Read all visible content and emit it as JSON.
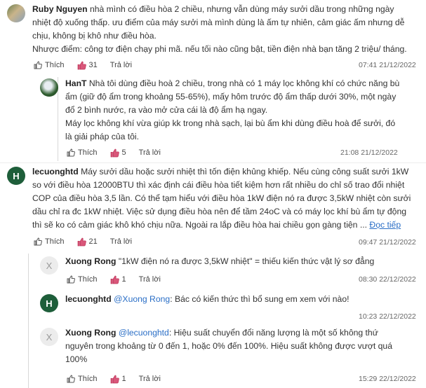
{
  "labels": {
    "like": "Thích",
    "reply": "Trả lời"
  },
  "comments": [
    {
      "author": "Ruby Nguyen",
      "text_line1": "nhà mình có điều hòa 2 chiều, nhưng vẫn dùng máy sưởi dầu trong những ngày",
      "text_line2": "nhiệt độ xuống thấp. ưu điểm của máy sưởi mà mình dùng là ấm tự nhiên, cảm giác ấm nhưng dễ",
      "text_line3": "chịu, không bị khô như điều hòa.",
      "text_line4": "Nhược điểm: công tơ điện chạy phi mã. nếu tối nào cũng bật, tiền điện nhà bạn tăng 2 triệu/ tháng.",
      "likes": "31",
      "time": "07:41 21/12/2022"
    },
    {
      "author": "HanT",
      "text_line1": "Nhà tôi dùng điều hoà 2 chiều, trong nhà có 1 máy lọc không khí có chức năng bù",
      "text_line2": "ẩm (giữ độ ẩm trong khoảng 55-65%), mấy hôm trước độ ẩm thấp dưới 30%, một ngày",
      "text_line3": "đổ 2 bình nước, ra vào mở cửa cái là độ ẩm hạ ngay.",
      "text_line4": "Máy lọc không khí vừa giúp kk trong nhà sạch, lại bù ẩm khi dùng điều hoà để sưởi, đó",
      "text_line5": "là giải pháp của tôi.",
      "likes": "5",
      "time": "21:08 21/12/2022"
    },
    {
      "author": "lecuonghtd",
      "avatar_letter": "H",
      "text_line1": "Máy sưởi dầu hoặc sưởi nhiệt thì tốn điện khủng khiếp. Nếu cùng công suất sưởi 1kW",
      "text_line2": "so với điều hòa 12000BTU thì xác định cái điều hòa tiết kiệm hơn rất nhiều do chỉ số trao đổi nhiệt",
      "text_line3": "COP của điều hòa 3,5 lần. Có thể tạm hiểu với điều hòa 1kW điện nó ra được 3,5kW nhiệt còn sưởi",
      "text_line4": "dầu chỉ ra đc 1kW nhiệt. Việc sử dụng điều hòa nên để tầm 24oC và có máy lọc khí bù ẩm tự động",
      "text_line5": "thì sẽ ko có cảm giác khô khó chịu nữa. Ngoài ra lắp điều hòa hai chiều gọn gàng tiện ...",
      "read_more": "Đọc tiếp",
      "likes": "21",
      "time": "09:47 21/12/2022"
    },
    {
      "author": "Xuong Rong",
      "avatar_letter": "X",
      "text_line1": "\"1kW điện nó ra được 3,5kW nhiệt\" = thiếu kiến thức vật lý sơ đẳng",
      "likes": "1",
      "time": "08:30 22/12/2022"
    },
    {
      "author": "lecuonghtd",
      "avatar_letter": "H",
      "mention": "@Xuong Rong",
      "text_line1": ": Bác có kiến thức thì bổ sung em xem với nào!",
      "time": "10:23 22/12/2022"
    },
    {
      "author": "Xuong Rong",
      "avatar_letter": "X",
      "mention": "@lecuonghtd",
      "text_line1": ": Hiệu suất chuyển đổi năng lượng là một số không thứ",
      "text_line2": "nguyên trong khoảng từ 0 đến 1, hoặc 0% đến 100%. Hiệu suất không được vượt quá",
      "text_line3": "100%",
      "likes": "1",
      "time": "15:29 22/12/2022"
    }
  ]
}
